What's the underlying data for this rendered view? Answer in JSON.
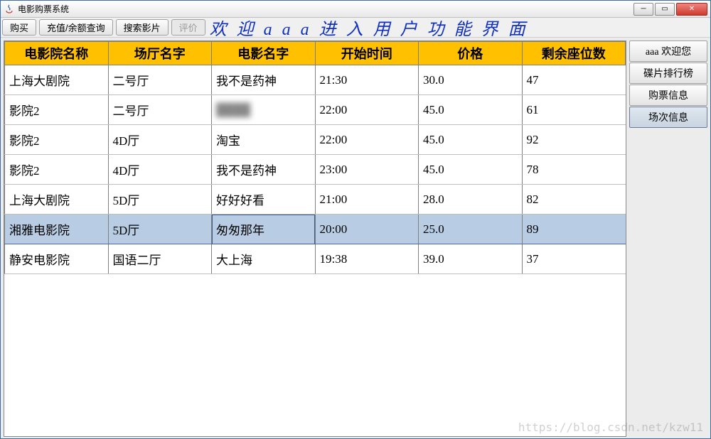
{
  "window": {
    "title": "电影购票系统"
  },
  "toolbar": {
    "buy": "购买",
    "recharge": "充值/余额查询",
    "search": "搜索影片",
    "review": "评价"
  },
  "banner": "欢迎aaa进入用户功能界面",
  "table": {
    "headers": [
      "电影院名称",
      "场厅名字",
      "电影名字",
      "开始时间",
      "价格",
      "剩余座位数"
    ],
    "rows": [
      {
        "cinema": "上海大剧院",
        "hall": "二号厅",
        "movie": "我不是药神",
        "start": "21:30",
        "price": "30.0",
        "seats": "47"
      },
      {
        "cinema": "影院2",
        "hall": "二号厅",
        "movie": "████",
        "start": "22:00",
        "price": "45.0",
        "seats": "61",
        "blur": true
      },
      {
        "cinema": "影院2",
        "hall": "4D厅",
        "movie": "淘宝",
        "start": "22:00",
        "price": "45.0",
        "seats": "92"
      },
      {
        "cinema": "影院2",
        "hall": "4D厅",
        "movie": "我不是药神",
        "start": "23:00",
        "price": "45.0",
        "seats": "78"
      },
      {
        "cinema": "上海大剧院",
        "hall": "5D厅",
        "movie": "好好好看",
        "start": "21:00",
        "price": "28.0",
        "seats": "82"
      },
      {
        "cinema": "湘雅电影院",
        "hall": "5D厅",
        "movie": "匆匆那年",
        "start": "20:00",
        "price": "25.0",
        "seats": "89",
        "selected": true
      },
      {
        "cinema": "静安电影院",
        "hall": "国语二厅",
        "movie": "大上海",
        "start": "19:38",
        "price": "39.0",
        "seats": "37"
      }
    ]
  },
  "sidebar": {
    "items": [
      {
        "label": "aaa 欢迎您"
      },
      {
        "label": "碟片排行榜"
      },
      {
        "label": "购票信息"
      },
      {
        "label": "场次信息",
        "active": true
      }
    ]
  },
  "watermark": "https://blog.csdn.net/kzw11"
}
